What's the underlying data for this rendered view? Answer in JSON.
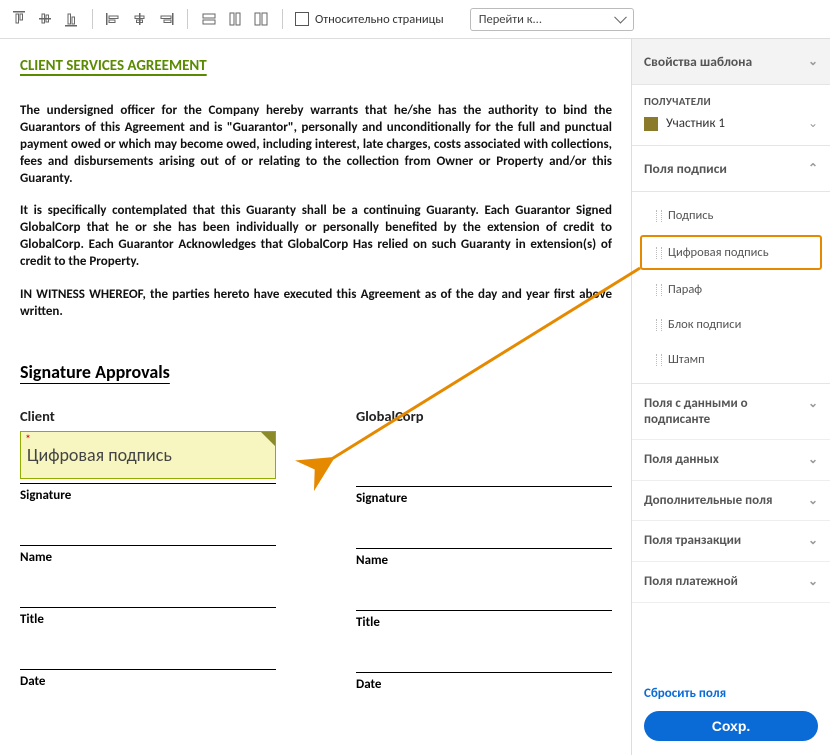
{
  "toolbar": {
    "relative_label": "Относительно страницы",
    "goto_label": "Перейти к..."
  },
  "doc": {
    "title": "CLIENT SERVICES AGREEMENT",
    "p1": "The undersigned officer for the Company hereby warrants that he/she has the authority to bind the Guarantors of this Agreement and is \"Guarantor\", personally and unconditionally for the full and punctual payment owed or which may become owed, including interest, late charges, costs associated with collections, fees and disbursements arising out of or relating to the collection from Owner or Property and/or this Guaranty.",
    "p2": "It is specifically contemplated that this Guaranty shall be a continuing Guaranty. Each Guarantor Signed GlobalCorp that he or she has been individually or personally benefited by the extension of credit to GlobalCorp. Each Guarantor Acknowledges that GlobalCorp Has relied on such Guaranty in extension(s) of credit to the Property.",
    "p3": "IN WITNESS WHEREOF, the parties hereto have executed this Agreement as of the day and year first above written.",
    "sig_heading": "Signature Approvals",
    "col1_head": "Client",
    "col2_head": "GlobalCorp",
    "field_label": "Цифровая подпись",
    "labels": {
      "signature": "Signature",
      "name": "Name",
      "title": "Title",
      "date": "Date"
    }
  },
  "sidebar": {
    "template_props": "Свойства шаблона",
    "recipients_title": "ПОЛУЧАТЕЛИ",
    "recipient1": "Участник 1",
    "sig_fields_header": "Поля подписи",
    "fields": {
      "signature": "Подпись",
      "digital": "Цифровая подпись",
      "initials": "Параф",
      "block": "Блок подписи",
      "stamp": "Штамп"
    },
    "groups": {
      "signer_data": "Поля с данными о подписанте",
      "data_fields": "Поля данных",
      "extra_fields": "Дополнительные поля",
      "transaction": "Поля транзакции",
      "payment": "Поля платежной"
    },
    "reset": "Сбросить поля",
    "save": "Сохр."
  }
}
